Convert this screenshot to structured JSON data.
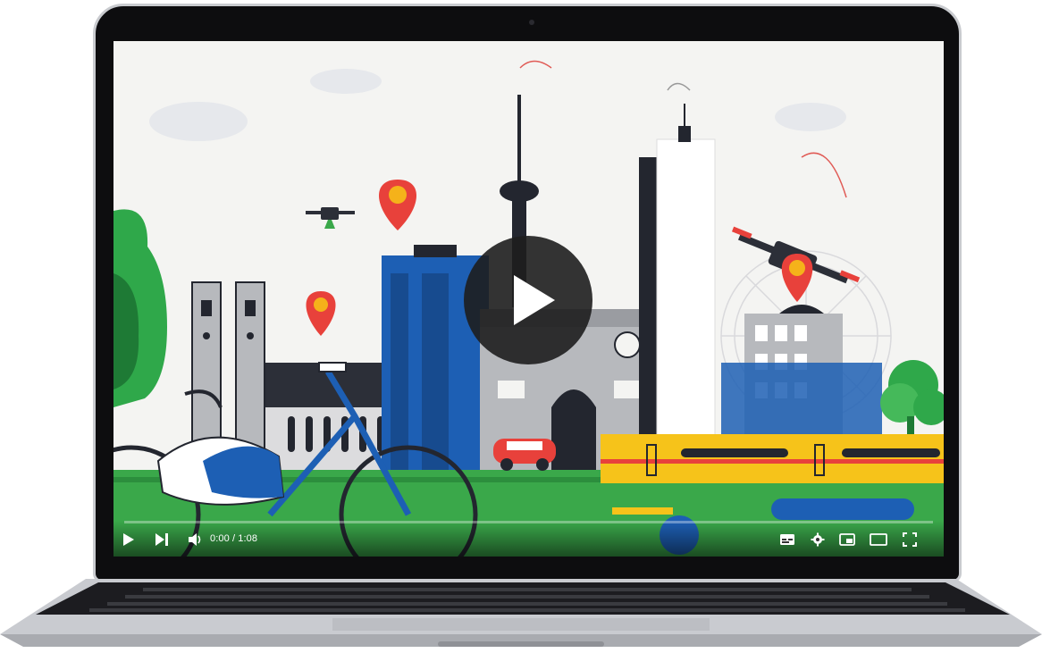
{
  "player": {
    "current_time": "0:00",
    "separator": " / ",
    "duration": "1:08",
    "progress_fraction": 0.0
  },
  "controls": {
    "left": [
      "play-icon",
      "next-icon",
      "volume-icon"
    ],
    "right": [
      "subtitles-icon",
      "settings-gear-icon",
      "miniplayer-icon",
      "theater-mode-icon",
      "fullscreen-icon"
    ]
  },
  "colors": {
    "primary_blue": "#1d5fb4",
    "pin_red": "#e8413b",
    "pin_yellow": "#f5b21a",
    "grass_green": "#3aa84a",
    "train_yellow": "#f6c31a",
    "building_gray": "#b7b9bd",
    "dark_navy": "#23262f"
  }
}
